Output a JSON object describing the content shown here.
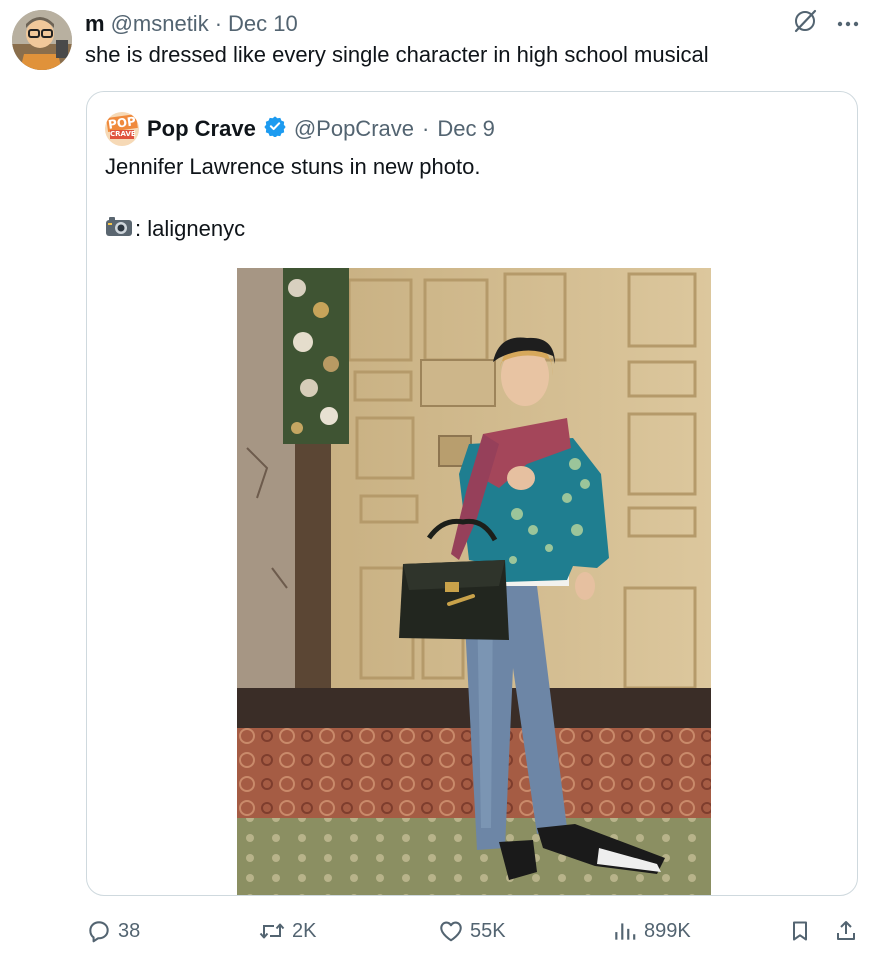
{
  "tweet": {
    "author_name": "m",
    "handle": "@msnetik",
    "separator": "·",
    "date": "Dec 10",
    "text": "she is dressed like every single character in high school musical"
  },
  "quoted": {
    "author_name": "Pop Crave",
    "handle": "@PopCrave",
    "separator": "·",
    "date": "Dec 9",
    "logo_text_top": "POP",
    "logo_text_bottom": "CRAVE",
    "text": "Jennifer Lawrence stuns in new photo.",
    "credit": ": lalignenyc",
    "verified": true
  },
  "actions": {
    "replies": "38",
    "reposts": "2K",
    "likes": "55K",
    "views": "899K"
  },
  "icons": {
    "more": "more-icon",
    "grok": "grok-icon",
    "reply": "reply-icon",
    "repost": "repost-icon",
    "like": "like-icon",
    "views": "views-icon",
    "bookmark": "bookmark-icon",
    "share": "share-icon",
    "camera": "camera-icon"
  },
  "colors": {
    "text": "#0f1419",
    "muted": "#536471",
    "border": "#cfd9de",
    "verified": "#1d9bf0"
  }
}
